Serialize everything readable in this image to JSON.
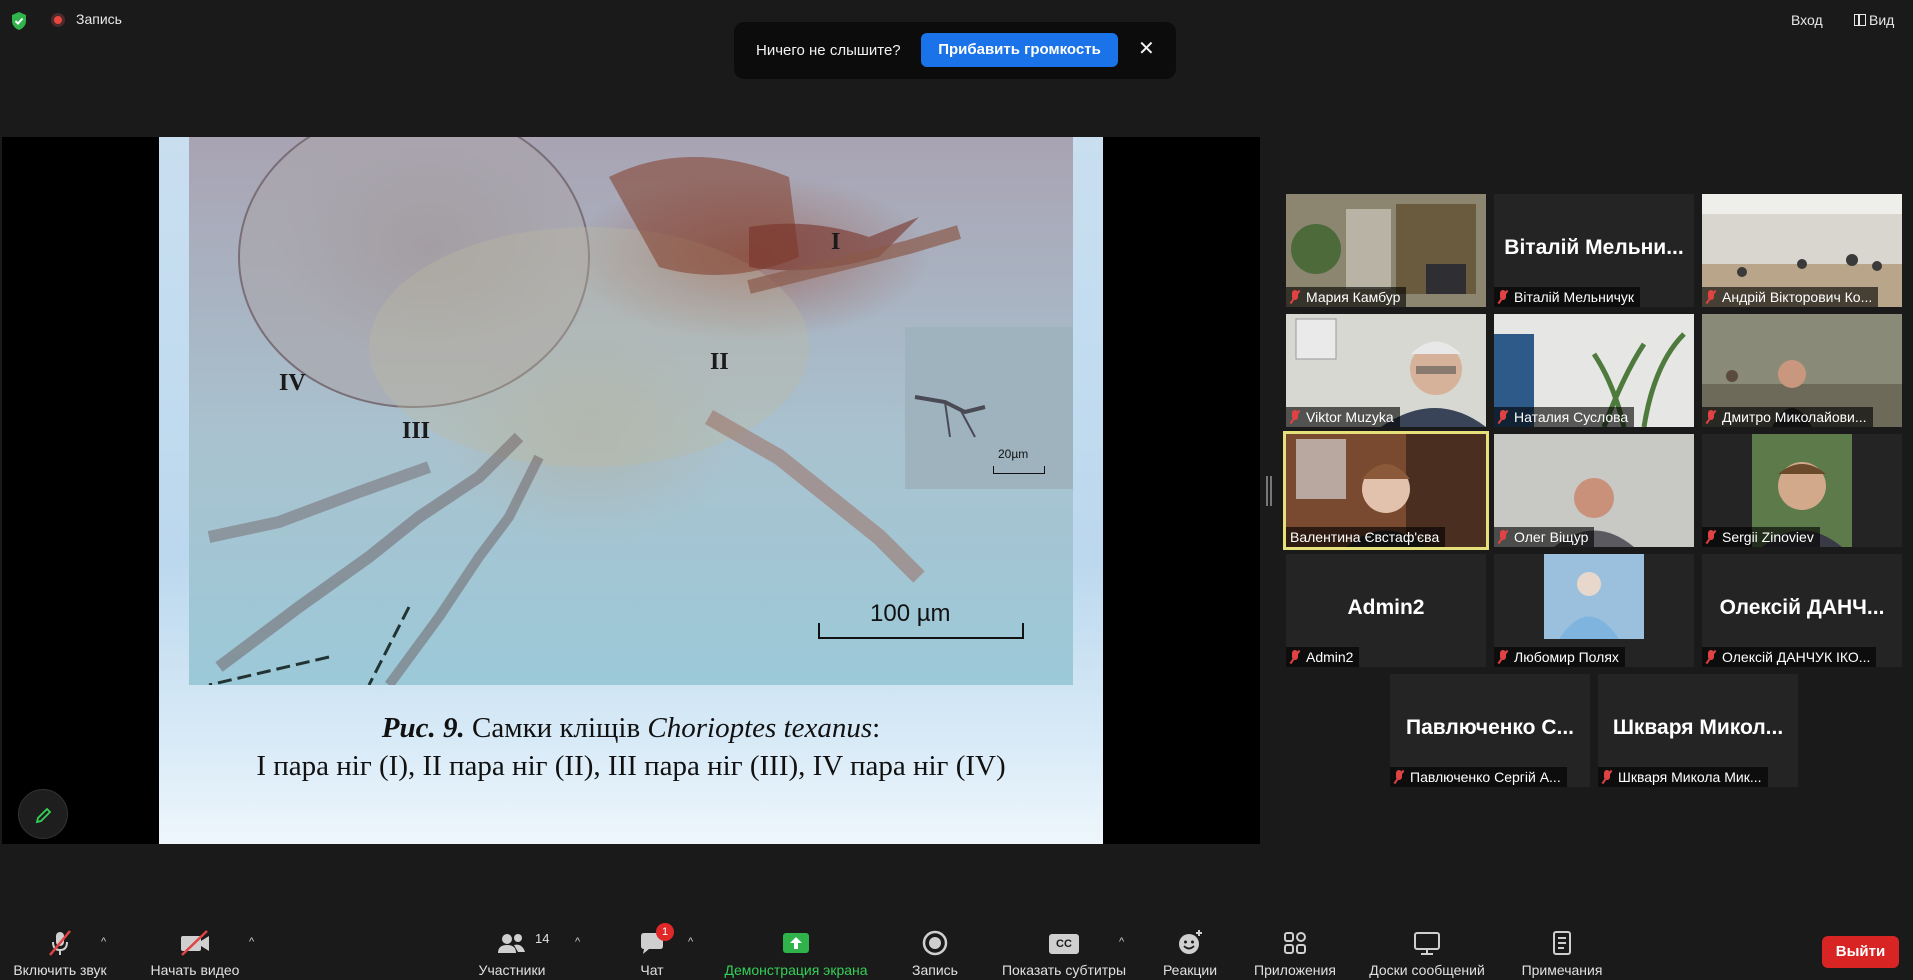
{
  "top": {
    "recording_label": "Запись",
    "signin_label": "Вход",
    "view_label": "Вид"
  },
  "notice": {
    "text": "Ничего не слышите?",
    "button": "Прибавить громкость",
    "close": "✕"
  },
  "slide": {
    "legs": [
      "I",
      "II",
      "III",
      "IV"
    ],
    "inset_scale": "20µm",
    "scale": "100 µm",
    "caption_fig": "Рис. 9.",
    "caption_line1": "Самки кліщів",
    "caption_species": "Chorioptes texanus",
    "caption_colon": ":",
    "caption_line2": "I пара ніг (I), II пара ніг (II), III пара ніг (III), IV пара ніг (IV)"
  },
  "participants": [
    {
      "name": "Мария Камбур",
      "video": true
    },
    {
      "name": "Віталій Мельничук",
      "big": "Віталій Мельни...",
      "video": false
    },
    {
      "name": "Андрій Вікторович Ко...",
      "video": true
    },
    {
      "name": "Viktor Muzyka",
      "video": true
    },
    {
      "name": "Наталия Суслова",
      "video": true
    },
    {
      "name": "Дмитро Миколайови...",
      "video": true
    },
    {
      "name": "Валентина Євстаф'єва",
      "video": true,
      "active": true
    },
    {
      "name": "Олег Віщур",
      "video": true
    },
    {
      "name": "Sergii Zinoviev",
      "video": true
    },
    {
      "name": "Admin2",
      "big": "Admin2",
      "video": false
    },
    {
      "name": "Любомир Полях",
      "video": true
    },
    {
      "name": "Олексій ДАНЧУК ІКО...",
      "big": "Олексій ДАНЧ...",
      "video": false
    },
    {
      "name": "Павлюченко Сергій А...",
      "big": "Павлюченко С...",
      "video": false
    },
    {
      "name": "Шкваря Микола Мик...",
      "big": "Шкваря Микол...",
      "video": false
    }
  ],
  "toolbar": {
    "unmute": "Включить звук",
    "start_video": "Начать видео",
    "participants": "Участники",
    "participants_count": "14",
    "chat": "Чат",
    "chat_badge": "1",
    "share": "Демонстрация экрана",
    "record": "Запись",
    "captions": "Показать субтитры",
    "captions_icon": "CC",
    "reactions": "Реакции",
    "apps": "Приложения",
    "whiteboards": "Доски сообщений",
    "notes": "Примечания",
    "leave": "Выйти"
  },
  "colors": {
    "accent": "#1a73e8",
    "leave": "#d92424",
    "active_speaker": "#e6e07a",
    "share_green": "#34d058",
    "mic_off": "#e04343"
  }
}
